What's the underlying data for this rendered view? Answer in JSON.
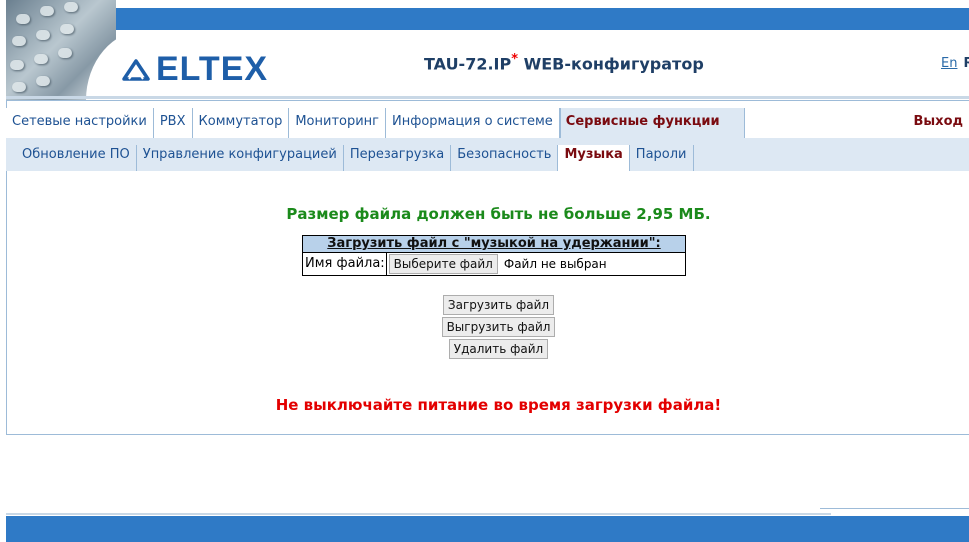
{
  "header": {
    "logo_text": "ELTEX",
    "title": "TAU-72.IP",
    "title_star": "*",
    "title_suffix": " WEB-конфигуратор",
    "lang_en": "En",
    "lang_ru": "Ru"
  },
  "main_menu": {
    "items": [
      "Сетевые настройки",
      "PBX",
      "Коммутатор",
      "Мониторинг",
      "Информация о системе",
      "Сервисные функции"
    ],
    "active": "Сервисные функции",
    "exit_label": "Выход"
  },
  "sub_menu": {
    "items": [
      "Обновление ПО",
      "Управление конфигурацией",
      "Перезагрузка",
      "Безопасность",
      "Музыка",
      "Пароли"
    ],
    "active": "Музыка"
  },
  "content": {
    "size_notice": "Размер файла должен быть не больше 2,95 МБ.",
    "upload_header": "Загрузить файл с \"музыкой на удержании\":",
    "file_label": "Имя файла:",
    "choose_button": "Выберите файл",
    "no_file": "Файл не выбран",
    "upload_button": "Загрузить файл",
    "download_button": "Выгрузить файл",
    "delete_button": "Удалить файл",
    "warning": "Не выключайте питание во время загрузки файла!"
  },
  "colors": {
    "accent_blue": "#2f7ac6",
    "menu_active": "#7a0b10",
    "notice_green": "#1b8a1b",
    "warning_red": "#e30000"
  }
}
